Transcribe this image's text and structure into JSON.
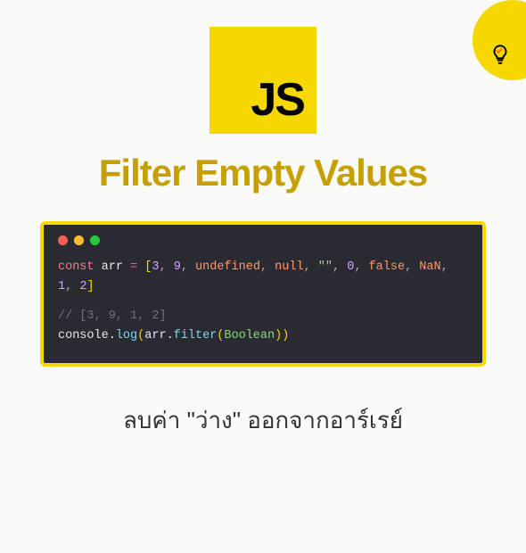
{
  "logo": {
    "text": "JS"
  },
  "title": "Filter Empty Values",
  "code": {
    "line1": {
      "const": "const",
      "varname": "arr",
      "eq": "=",
      "lbracket": "[",
      "v1": "3",
      "v2": "9",
      "v3": "undefined",
      "v4": "null",
      "v5": "\"\"",
      "v6": "0",
      "v7": "false",
      "v8": "NaN",
      "v9": "1",
      "v10": "2",
      "rbracket": "]",
      "comma": ","
    },
    "comment": "// [3, 9, 1, 2]",
    "line2": {
      "console": "console",
      "dot": ".",
      "log": "log",
      "lparen": "(",
      "arr": "arr",
      "filter": "filter",
      "boolean": "Boolean",
      "rparen": ")"
    }
  },
  "caption": "ลบค่า \"ว่าง\" ออกจากอาร์เรย์"
}
